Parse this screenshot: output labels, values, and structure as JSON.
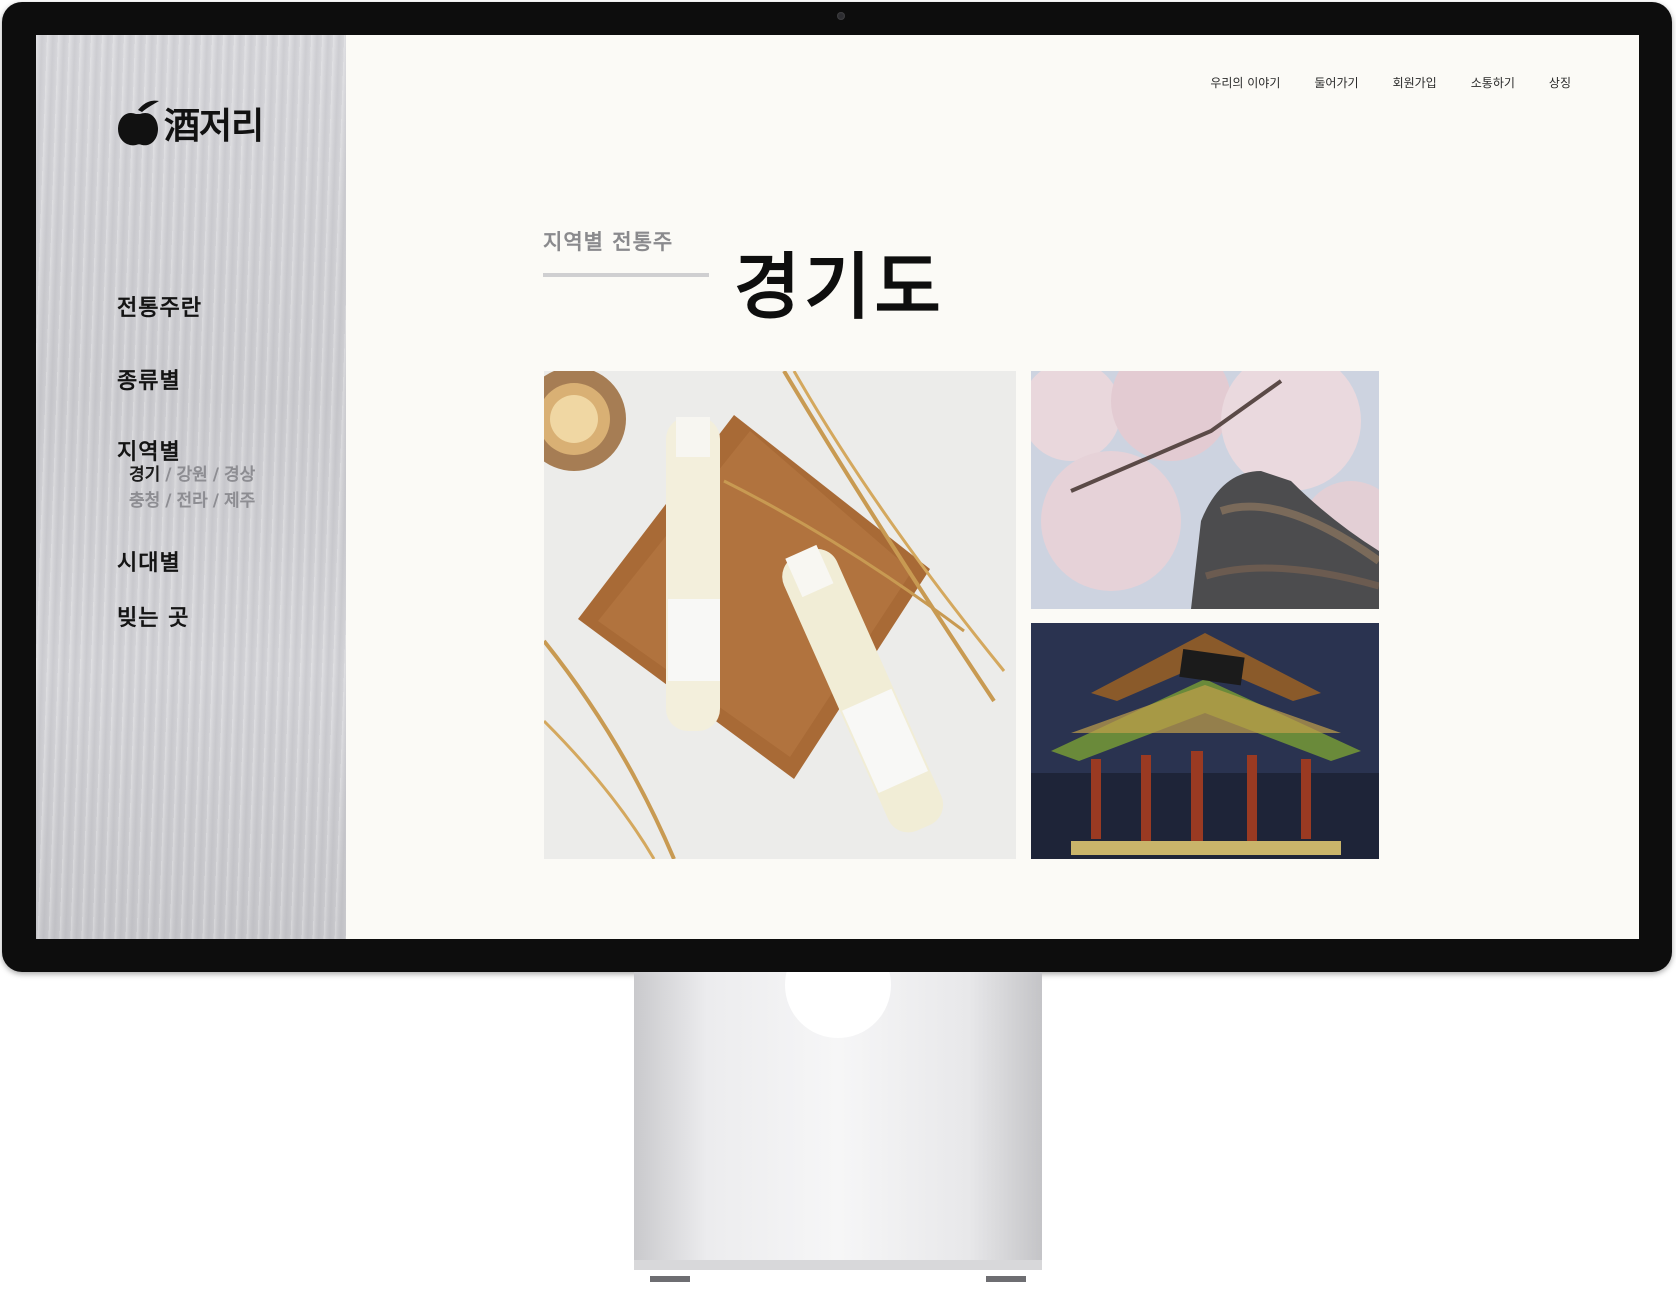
{
  "brand": {
    "logo_text": "酒저리",
    "logo_icon": "apple-bottle-icon"
  },
  "sidebar": {
    "items": [
      {
        "label": "전통주란"
      },
      {
        "label": "종류별"
      },
      {
        "label": "지역별"
      },
      {
        "label": "시대별"
      },
      {
        "label": "빚는 곳"
      }
    ],
    "regions": {
      "row1": [
        "경기",
        "강원",
        "경상"
      ],
      "row2": [
        "충청",
        "전라",
        "제주"
      ],
      "active": "경기",
      "separator": "/"
    }
  },
  "top_nav": [
    "우리의 이야기",
    "둘어가기",
    "회원가입",
    "소통하기",
    "상징"
  ],
  "page": {
    "subtitle": "지역별 전통주",
    "title": "경기도"
  },
  "images": {
    "main": "makgeolli-bottles-photo",
    "top_right": "cherry-blossom-roof-photo",
    "bottom_right": "pavilion-night-photo"
  },
  "colors": {
    "sidebar_bg": "#d2d2d6",
    "main_bg": "#fbfaf6",
    "region_inactive": "#8d8d92",
    "text_primary": "#111111"
  }
}
